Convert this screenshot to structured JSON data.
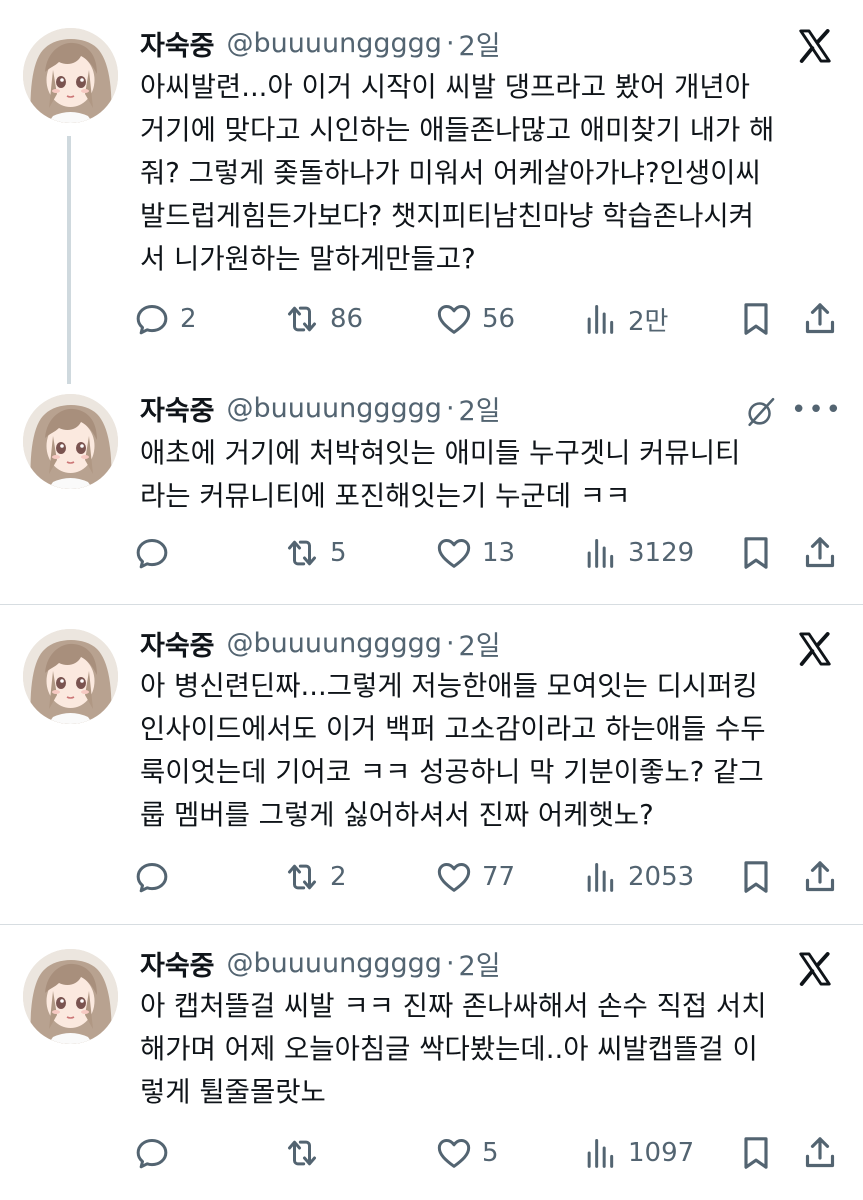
{
  "tweets": [
    {
      "name": "자숙중",
      "handle": "@buuuunggggg",
      "separator": "·",
      "time": "2일",
      "lines": [
        "아씨발련...아 이거 시작이 씨발 댕프라고 봤어 개년아",
        "거기에 맞다고 시인하는 애들존나많고 애미찾기 내가 해",
        "줘? 그렇게 좆돌하나가 미워서 어케살아가냐?인생이씨",
        "발드럽게힘든가보다? 챗지피티남친마냥 학습존나시켜",
        "서 니가원하는 말하게만들고?"
      ],
      "replies": "2",
      "retweets": "86",
      "likes": "56",
      "views": "2만"
    },
    {
      "name": "자숙중",
      "handle": "@buuuunggggg",
      "separator": "·",
      "time": "2일",
      "lines": [
        "애초에 거기에 처박혀잇는 애미들 누구겟니 커뮤니티",
        "라는 커뮤니티에 포진해잇는기 누군데 ㅋㅋ"
      ],
      "replies": "",
      "retweets": "5",
      "likes": "13",
      "views": "3129"
    },
    {
      "name": "자숙중",
      "handle": "@buuuunggggg",
      "separator": "·",
      "time": "2일",
      "lines": [
        "아 병신련딘짜...그렇게 저능한애들 모여잇는 디시퍼킹",
        "인사이드에서도 이거 백퍼 고소감이라고 하는애들 수두",
        "룩이엇는데 기어코 ㅋㅋ 성공하니 막 기분이좋노? 같그",
        "룹 멤버를 그렇게 싫어하셔서 진짜 어케햇노?"
      ],
      "replies": "",
      "retweets": "2",
      "likes": "77",
      "views": "2053"
    },
    {
      "name": "자숙중",
      "handle": "@buuuunggggg",
      "separator": "·",
      "time": "2일",
      "lines": [
        "아 캡처뜰걸 씨발 ㅋㅋ 진짜 존나싸해서 손수 직접 서치",
        "해가며 어제 오늘아침글 싹다봤는데..아 씨발캡뜰걸 이",
        "렇게 튈줄몰랏노"
      ],
      "replies": "",
      "retweets": "",
      "likes": "5",
      "views": "1097"
    }
  ],
  "icons": {
    "reply": "reply-icon",
    "retweet": "retweet-icon",
    "like": "heart-icon",
    "views": "views-icon",
    "bookmark": "bookmark-icon",
    "share": "share-icon",
    "x_logo": "x-logo-icon",
    "grok": "grok-icon",
    "more": "more-icon"
  },
  "colors": {
    "text": "#0f1419",
    "muted": "#536471",
    "thread_line": "#cfd9de",
    "divider": "#d7dde1"
  }
}
